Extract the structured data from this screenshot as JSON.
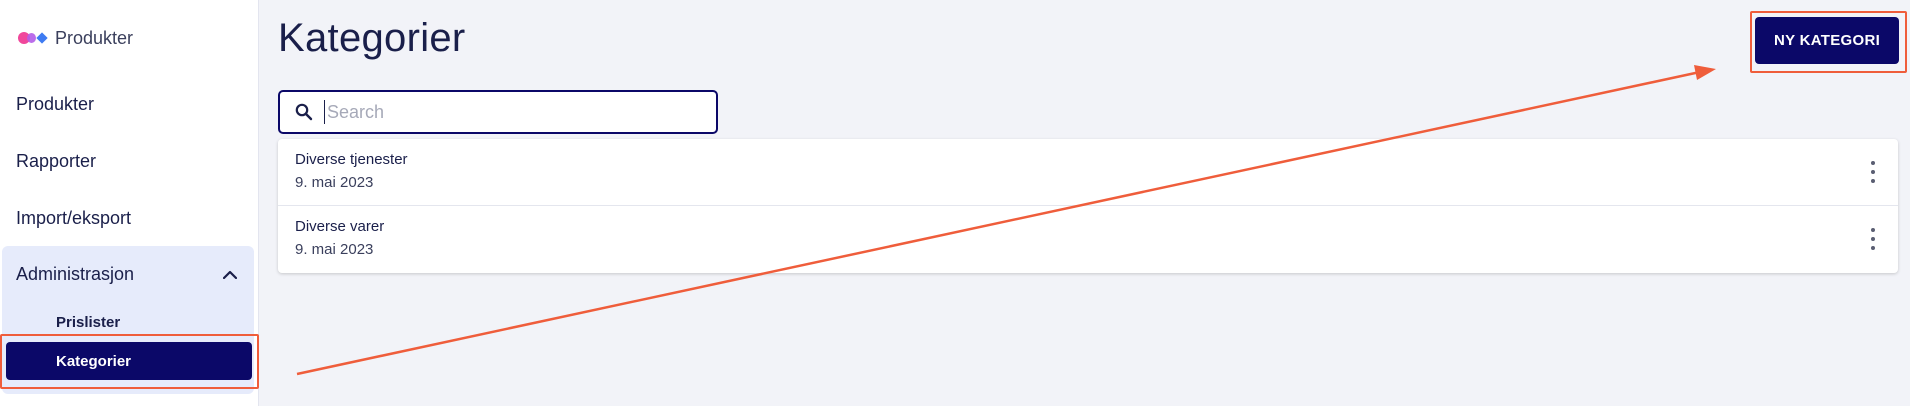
{
  "brand": {
    "label": "Produkter",
    "icon": "app-logo-icon"
  },
  "sidebar": {
    "items": [
      {
        "label": "Produkter"
      },
      {
        "label": "Rapporter"
      },
      {
        "label": "Import/eksport"
      }
    ],
    "group": {
      "label": "Administrasjon",
      "expanded": true,
      "children": [
        {
          "label": "Prislister"
        },
        {
          "label": "Kategorier",
          "selected": true
        }
      ]
    }
  },
  "main": {
    "title": "Kategorier",
    "new_button_label": "NY KATEGORI",
    "search": {
      "placeholder": "Search",
      "value": ""
    },
    "rows": [
      {
        "name": "Diverse tjenester",
        "date": "9. mai 2023"
      },
      {
        "name": "Diverse varer",
        "date": "9. mai 2023"
      }
    ]
  },
  "colors": {
    "accent": "#0b0868",
    "annotation": "#ef5d3b",
    "sidebar_group_bg": "#e6ebfb"
  }
}
